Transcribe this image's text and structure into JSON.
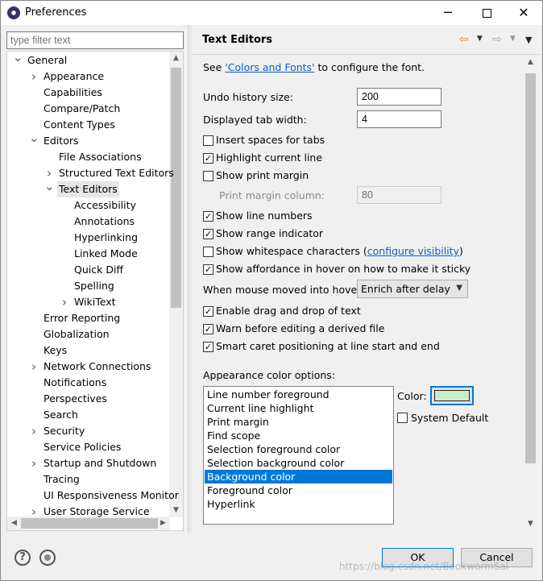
{
  "window": {
    "title": "Preferences",
    "minimize": "─",
    "close": "✕"
  },
  "filter": {
    "placeholder": "type filter text"
  },
  "tree": {
    "items": [
      {
        "label": "General",
        "level": 0,
        "twisty": "expanded"
      },
      {
        "label": "Appearance",
        "level": 1,
        "twisty": "collapsed"
      },
      {
        "label": "Capabilities",
        "level": 1,
        "twisty": "none"
      },
      {
        "label": "Compare/Patch",
        "level": 1,
        "twisty": "none"
      },
      {
        "label": "Content Types",
        "level": 1,
        "twisty": "none"
      },
      {
        "label": "Editors",
        "level": 1,
        "twisty": "expanded"
      },
      {
        "label": "File Associations",
        "level": 2,
        "twisty": "none"
      },
      {
        "label": "Structured Text Editors",
        "level": 2,
        "twisty": "collapsed"
      },
      {
        "label": "Text Editors",
        "level": 2,
        "twisty": "expanded",
        "selected": true
      },
      {
        "label": "Accessibility",
        "level": 3,
        "twisty": "none"
      },
      {
        "label": "Annotations",
        "level": 3,
        "twisty": "none"
      },
      {
        "label": "Hyperlinking",
        "level": 3,
        "twisty": "none"
      },
      {
        "label": "Linked Mode",
        "level": 3,
        "twisty": "none"
      },
      {
        "label": "Quick Diff",
        "level": 3,
        "twisty": "none"
      },
      {
        "label": "Spelling",
        "level": 3,
        "twisty": "none"
      },
      {
        "label": "WikiText",
        "level": 3,
        "twisty": "collapsed"
      },
      {
        "label": "Error Reporting",
        "level": 1,
        "twisty": "none"
      },
      {
        "label": "Globalization",
        "level": 1,
        "twisty": "none"
      },
      {
        "label": "Keys",
        "level": 1,
        "twisty": "none"
      },
      {
        "label": "Network Connections",
        "level": 1,
        "twisty": "collapsed"
      },
      {
        "label": "Notifications",
        "level": 1,
        "twisty": "none"
      },
      {
        "label": "Perspectives",
        "level": 1,
        "twisty": "none"
      },
      {
        "label": "Search",
        "level": 1,
        "twisty": "none"
      },
      {
        "label": "Security",
        "level": 1,
        "twisty": "collapsed"
      },
      {
        "label": "Service Policies",
        "level": 1,
        "twisty": "none"
      },
      {
        "label": "Startup and Shutdown",
        "level": 1,
        "twisty": "collapsed"
      },
      {
        "label": "Tracing",
        "level": 1,
        "twisty": "none"
      },
      {
        "label": "UI Responsiveness Monitor",
        "level": 1,
        "twisty": "none"
      },
      {
        "label": "User Storage Service",
        "level": 1,
        "twisty": "collapsed"
      }
    ]
  },
  "page": {
    "title": "Text Editors",
    "see_prefix": "See ",
    "see_link": "'Colors and Fonts'",
    "see_suffix": " to configure the font.",
    "undo_label": "Undo history size:",
    "undo_value": "200",
    "tab_label": "Displayed tab width:",
    "tab_value": "4",
    "checkboxes": [
      {
        "label": "Insert spaces for tabs",
        "checked": false
      },
      {
        "label": "Highlight current line",
        "checked": true
      },
      {
        "label": "Show print margin",
        "checked": false
      }
    ],
    "print_margin_label": "Print margin column:",
    "print_margin_value": "80",
    "checkboxes2": [
      {
        "label": "Show line numbers",
        "checked": true
      },
      {
        "label": "Show range indicator",
        "checked": true
      },
      {
        "label": "Show whitespace characters (",
        "link": "configure visibility",
        "suffix": ")",
        "checked": false
      },
      {
        "label": "Show affordance in hover on how to make it sticky",
        "checked": true
      }
    ],
    "hover_label": "When mouse moved into hover:",
    "hover_value": "Enrich after delay",
    "checkboxes3": [
      {
        "label": "Enable drag and drop of text",
        "checked": true
      },
      {
        "label": "Warn before editing a derived file",
        "checked": true
      },
      {
        "label": "Smart caret positioning at line start and end",
        "checked": true
      }
    ],
    "appearance_label": "Appearance color options:",
    "color_options": [
      "Line number foreground",
      "Current line highlight",
      "Print margin",
      "Find scope",
      "Selection foreground color",
      "Selection background color",
      "Background color",
      "Foreground color",
      "Hyperlink"
    ],
    "selected_color_option": "Background color",
    "color_label": "Color:",
    "color_value": "#c7edcc",
    "system_default_label": "System Default",
    "system_default_checked": false
  },
  "buttons": {
    "help": "?",
    "ok": "OK",
    "cancel": "Cancel"
  },
  "watermark": "https://blog.csdn.net/BookwormSai"
}
